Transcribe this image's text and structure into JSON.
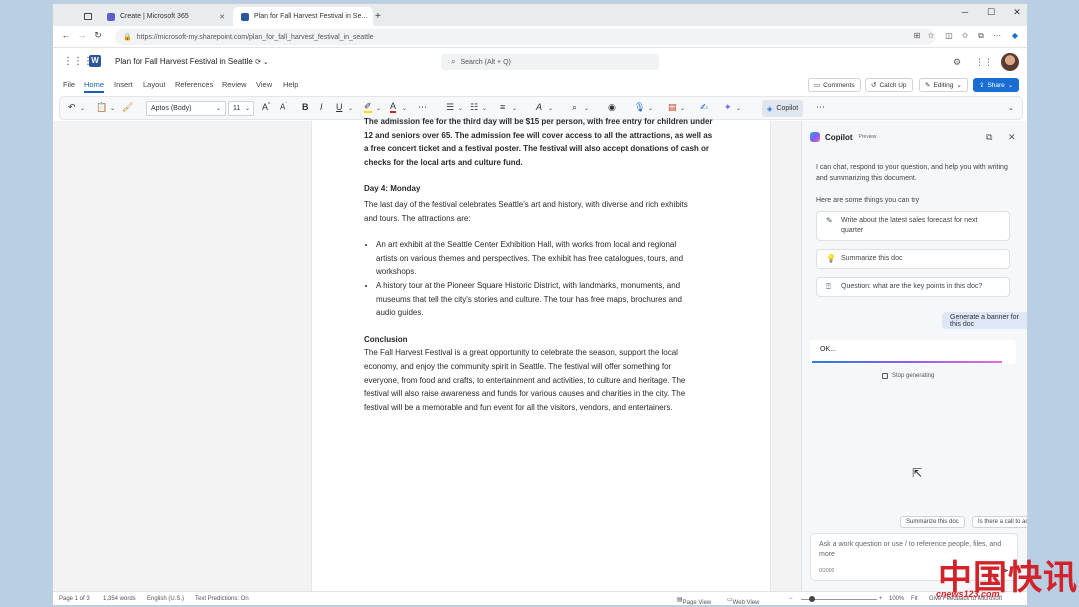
{
  "browser": {
    "tabs": [
      {
        "label": "Create | Microsoft 365",
        "color": "#5b5fc7"
      },
      {
        "label": "Plan for Fall Harvest Festival in Se...",
        "color": "#2b579a"
      }
    ],
    "new_tab": "+",
    "url": "https://microsoft-my.sharepoint.com/plan_for_fall_harvest_festival_in_seattle",
    "window_controls": [
      "─",
      "☐",
      "✕"
    ]
  },
  "word": {
    "app_letter": "W",
    "doc_title": "Plan for Fall Harvest Festival in Seattle",
    "search_placeholder": "Search (Alt + Q)",
    "ribbon_tabs": [
      "File",
      "Home",
      "Insert",
      "Layout",
      "References",
      "Review",
      "View",
      "Help"
    ],
    "ribbon_buttons": {
      "comments": "Comments",
      "catchup": "Catch Up",
      "editing": "Editing",
      "share": "Share"
    },
    "toolbar": {
      "font": "Aptos (Body)",
      "size": "11",
      "copilot": "Copilot"
    }
  },
  "document": {
    "para1_a": "The admission fee for the third day will be $15 per person, with free entry for children under",
    "para1_b": "12 and seniors over 65. The admission fee will cover access to all the attractions, as well as",
    "para1_c": "a free concert ticket and a festival poster. The festival will also accept donations of cash or",
    "para1_d": "checks for the local arts and culture fund.",
    "day4_heading": "Day 4: Monday",
    "day4_intro_a": "The last day of the festival celebrates Seattle's art and history, with diverse and rich exhibits",
    "day4_intro_b": "and tours. The attractions are:",
    "bullet1_a": "An art exhibit at the Seattle Center Exhibition Hall, with works from local and regional",
    "bullet1_b": "artists on various themes and perspectives. The exhibit has free catalogues, tours, and",
    "bullet1_c": "workshops.",
    "bullet2_a": "A history tour at the Pioneer Square Historic District, with landmarks, monuments, and",
    "bullet2_b": "museums that tell the city's stories and culture. The tour has free maps, brochures and",
    "bullet2_c": "audio guides.",
    "conclusion_heading": "Conclusion",
    "conclusion_a": "The Fall Harvest Festival is a great opportunity to celebrate the season, support the local",
    "conclusion_b": "economy, and enjoy the community spirit in Seattle. The festival will offer something for",
    "conclusion_c": "everyone, from food and crafts, to entertainment and activities, to culture and heritage. The",
    "conclusion_d": "festival will also raise awareness and funds for various causes and charities in the city. The",
    "conclusion_e": "festival will be a memorable and fun event for all the visitors, vendors, and entertainers."
  },
  "copilot": {
    "title": "Copilot",
    "badge": "Preview",
    "intro": "I can chat, respond to your question, and help you with writing and summarizing this document.",
    "try_label": "Here are some things you can try",
    "suggestions": [
      {
        "icon": "pen-icon",
        "text": "Write about the latest sales forecast for next quarter"
      },
      {
        "icon": "lightbulb-icon",
        "text": "Summarize this doc"
      },
      {
        "icon": "question-doc-icon",
        "text": "Question: what are the key points in this doc?"
      }
    ],
    "user_prompt": "Generate a banner for this doc",
    "response": "OK...",
    "stop_label": "Stop generating",
    "chips": [
      "Summarize this doc",
      "Is there a call to action?"
    ],
    "composer_placeholder": "Ask a work question or use / to reference people, files, and more",
    "composer_counter": "0/2000"
  },
  "status": {
    "page": "Page 1 of 3",
    "words": "1,354 words",
    "language": "English (U.S.)",
    "predictions": "Text Predictions: On",
    "page_view": "Page View",
    "web_view": "Web View",
    "zoom_minus": "−",
    "zoom_plus": "+",
    "zoom_level": "100%",
    "fit": "Fit",
    "feedback": "Give Feedback to Microsoft"
  },
  "watermark": {
    "text": "中国快讯",
    "url": "cnews123.com"
  }
}
